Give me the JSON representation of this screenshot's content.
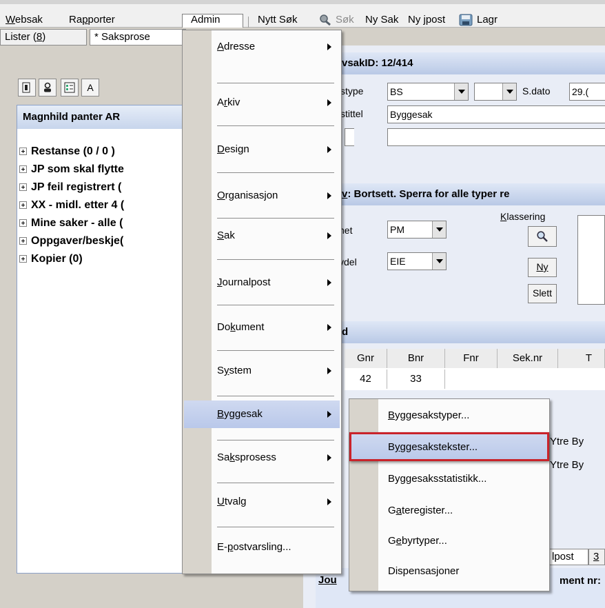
{
  "menubar": {
    "items": [
      "Websak",
      "Rapporter",
      "Admin"
    ],
    "toolbar": [
      "Nytt Søk",
      "Søk",
      "Ny Sak",
      "Ny jpost",
      "Lagr"
    ]
  },
  "left": {
    "tab1": "Lister (8)",
    "tab2": "* Saksprose",
    "toolbar_btn": "A",
    "list_header": "Magnhild panter AR",
    "tree": [
      "Restanse (0 / 0 )",
      "JP som skal flytte",
      "JP feil registrert (",
      "XX - midl. etter 4 (",
      "Mine saker - alle (",
      "Oppgaver/beskje(",
      "Kopier (0)"
    ]
  },
  "form": {
    "sakid": "vsakID: 12/414",
    "stype_label": "stype",
    "stype_value": "BS",
    "sdato_label": "S.dato",
    "sdato_value": "29.(",
    "stittel_label": "stittel",
    "stittel_value": "Byggesak",
    "notice": "v: Bortsett. Sperra for alle typer re",
    "enhet_label": "het",
    "enhet_value": "PM",
    "avdel_label": "vdel",
    "avdel_value": "EIE",
    "klassering_label": "Klassering",
    "btn_ny": "Ny",
    "btn_slett": "Slett",
    "grid_title": "d",
    "grid_headers": [
      "Gnr",
      "Bnr",
      "Fnr",
      "Sek.nr",
      "T"
    ],
    "grid_row": [
      "42",
      "33"
    ],
    "ytre1": "Ytre By",
    "ytre2": "Ytre By",
    "lpost_tab": "lpost",
    "lpost_tab2": "3",
    "jou": "Jou",
    "ment": "ment nr:"
  },
  "admin_menu": [
    {
      "label": "Adresse",
      "mn": "A",
      "rest": "dresse",
      "sub": true
    },
    {
      "label": "Arkiv",
      "pre": "A",
      "mn": "r",
      "rest": "kiv",
      "sub": true
    },
    {
      "label": "Design",
      "mn": "D",
      "rest": "esign",
      "sub": true
    },
    {
      "label": "Organisasjon",
      "mn": "O",
      "rest": "rganisasjon",
      "sub": true
    },
    {
      "label": "Sak",
      "mn": "S",
      "rest": "ak",
      "sub": true
    },
    {
      "label": "Journalpost",
      "mn": "J",
      "rest": "ournalpost",
      "sub": true
    },
    {
      "label": "Dokument",
      "pre": "Do",
      "mn": "k",
      "rest": "ument",
      "sub": true
    },
    {
      "label": "System",
      "pre": "S",
      "mn": "y",
      "rest": "stem",
      "sub": true
    },
    {
      "label": "Byggesak",
      "mn": "B",
      "rest": "yggesak",
      "sub": true
    },
    {
      "label": "Saksprosess",
      "pre": "Sa",
      "mn": "k",
      "rest": "sprosess",
      "sub": true
    },
    {
      "label": "Utvalg",
      "mn": "U",
      "rest": "tvalg",
      "sub": true
    },
    {
      "label": "E-postvarsling...",
      "pre": "E-",
      "mn": "p",
      "rest": "ostvarsling...",
      "sub": false
    }
  ],
  "byggesak_menu": [
    {
      "label": "Byggesakstyper...",
      "mn": "B",
      "rest": "yggesakstyper..."
    },
    {
      "label": "Byggesakstekster...",
      "pre": "B",
      "mn": "y",
      "rest": "ggesakstekster..."
    },
    {
      "label": "Byggesaksstatistikk...",
      "pre": "By",
      "mn": "g",
      "rest": "gesaksstatistikk..."
    },
    {
      "label": "Gateregister...",
      "pre": "G",
      "mn": "a",
      "rest": "teregister..."
    },
    {
      "label": "Gebyrtyper...",
      "pre": "G",
      "mn": "e",
      "rest": "byrtyper..."
    },
    {
      "label": "Dispensasjoner"
    }
  ]
}
